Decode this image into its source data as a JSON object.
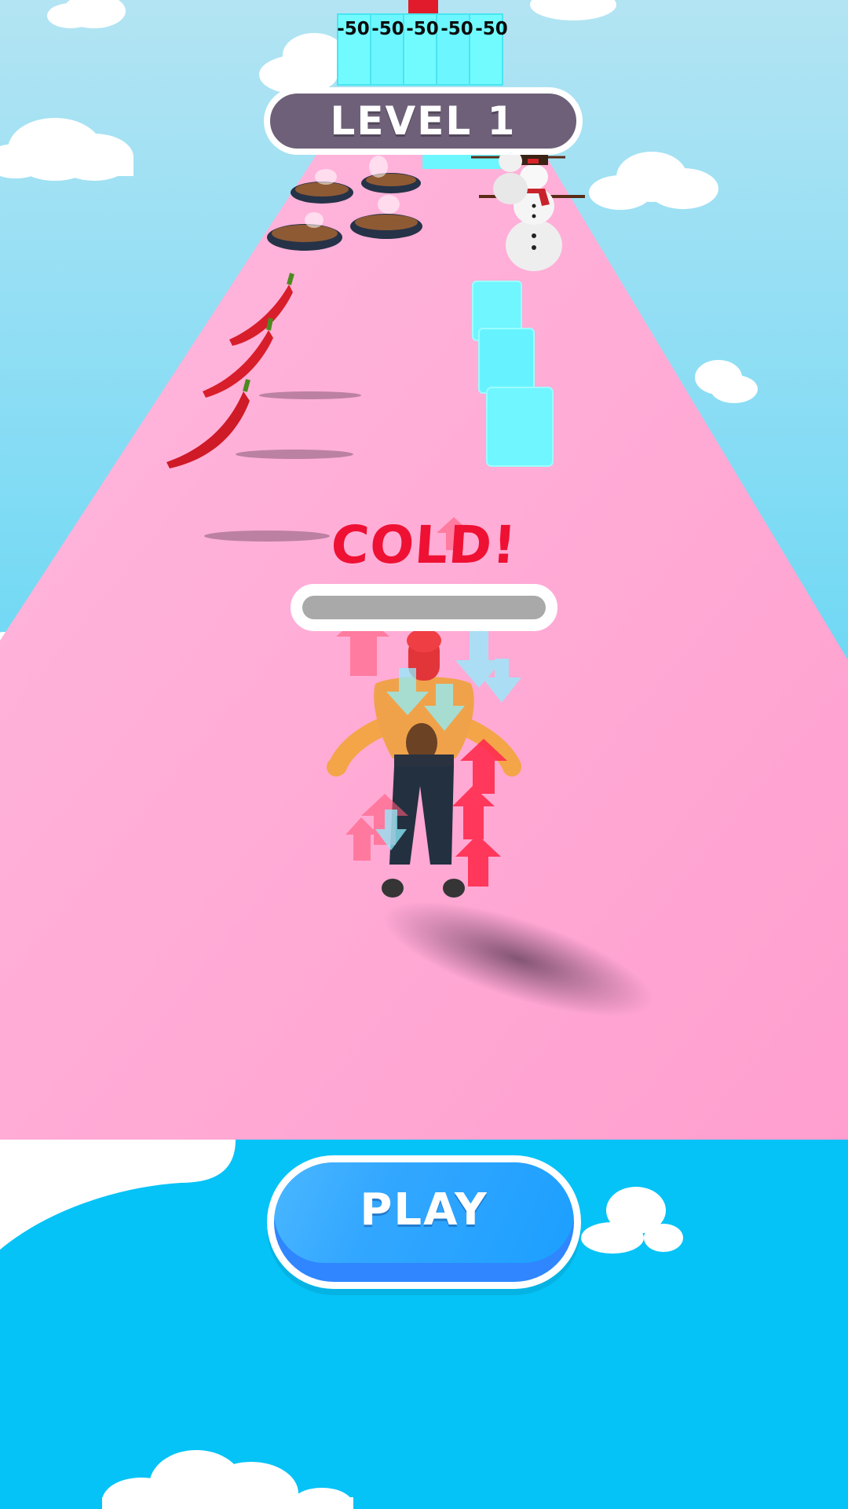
{
  "game": {
    "level_label": "LEVEL 1",
    "status_text": "COLD!",
    "temperature_level": 0.0,
    "gate_labels": [
      "-50",
      "-50",
      "-50",
      "-50",
      "-50"
    ],
    "play_label": "PLAY"
  },
  "colors": {
    "sky": "#a8def0",
    "lower_sky": "#05c3f7",
    "track": "#ffb3dc",
    "ice": "#6ffcff",
    "level_pill": "#6e6078",
    "status_red": "#ee1133",
    "play_blue": "#2f86ff",
    "arrow_red": "#ff3b5c",
    "arrow_cyan": "#8ff0ff"
  },
  "icons": [
    "chili-pepper-icon",
    "hot-pan-icon",
    "snowman-icon",
    "ice-cube-icon",
    "heat-arrow-icon",
    "cold-arrow-icon"
  ]
}
